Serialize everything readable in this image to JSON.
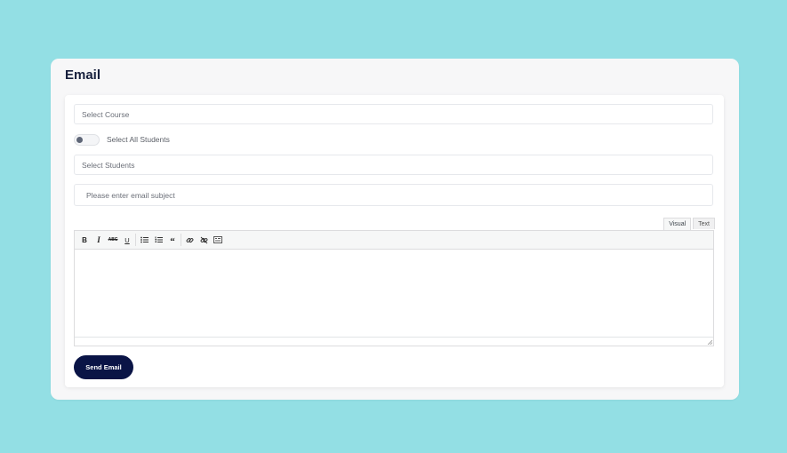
{
  "page": {
    "title": "Email"
  },
  "form": {
    "course_placeholder": "Select Course",
    "select_all_label": "Select All Students",
    "select_all_checked": false,
    "students_placeholder": "Select Students",
    "subject_placeholder": "Please enter email subject"
  },
  "editor": {
    "tabs": [
      {
        "label": "Visual",
        "active": true
      },
      {
        "label": "Text",
        "active": false
      }
    ],
    "toolbar": {
      "bold_glyph": "B",
      "italic_glyph": "I",
      "strike_glyph": "ABC",
      "underline_glyph": "U",
      "quote_glyph": "“"
    },
    "content": ""
  },
  "actions": {
    "send_label": "Send Email"
  },
  "colors": {
    "background": "#93dfe4",
    "primary_button": "#0a1446",
    "title": "#17203d"
  }
}
